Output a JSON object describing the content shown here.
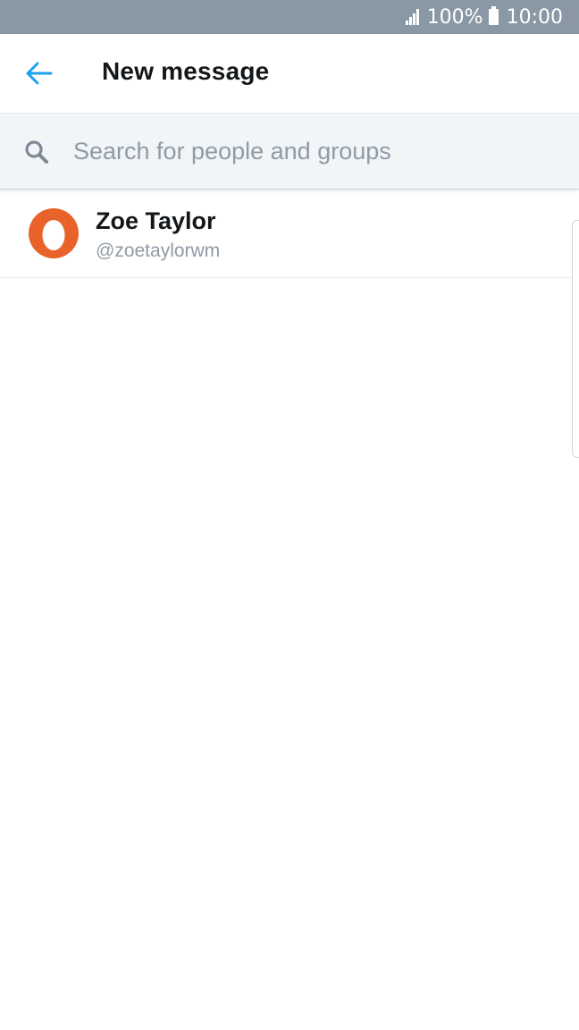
{
  "status_bar": {
    "battery_percent": "100%",
    "time": "10:00",
    "icons": [
      "signal-icon",
      "battery-icon"
    ]
  },
  "header": {
    "back_icon": "arrow-left-icon",
    "title": "New message"
  },
  "search": {
    "icon": "search-icon",
    "placeholder": "Search for people and groups",
    "value": ""
  },
  "results": [
    {
      "name": "Zoe Taylor",
      "handle": "@zoetaylorwm",
      "avatar": "default-egg-avatar"
    }
  ],
  "colors": {
    "accent": "#1da1f2",
    "status_bar": "#8a98a6",
    "avatar": "#e8622a",
    "search_bg": "#f2f5f8",
    "text_primary": "#14171a",
    "text_secondary": "#8f9ba6"
  }
}
